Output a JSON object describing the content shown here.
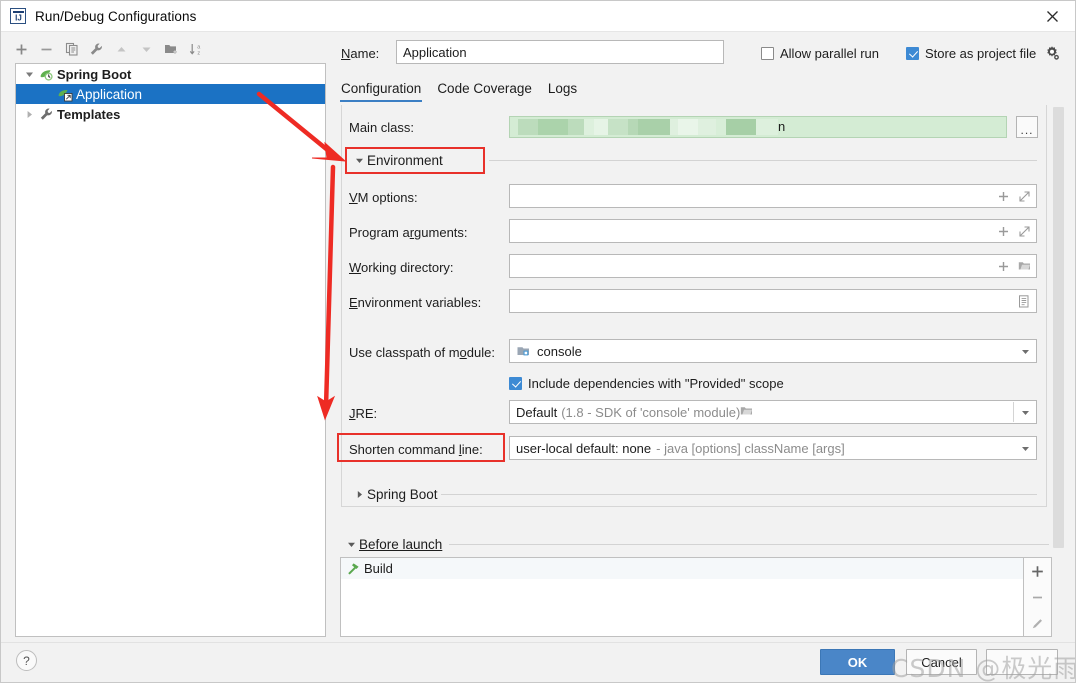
{
  "window": {
    "title": "Run/Debug Configurations",
    "app_icon": "intellij-idea-icon",
    "close_label": "✕"
  },
  "toolbar": {
    "items": [
      {
        "name": "add-configuration-button",
        "icon": "plus-icon",
        "label": "+"
      },
      {
        "name": "remove-configuration-button",
        "icon": "minus-icon",
        "label": "−"
      },
      {
        "name": "copy-configuration-button",
        "icon": "copy-icon",
        "label": "Copy"
      },
      {
        "name": "edit-templates-button",
        "icon": "wrench-icon",
        "label": "Edit Templates"
      },
      {
        "name": "move-up-button",
        "icon": "arrow-up-icon",
        "label": "Move Up"
      },
      {
        "name": "move-down-button",
        "icon": "arrow-down-icon",
        "label": "Move Down"
      },
      {
        "name": "move-into-folder-button",
        "icon": "folder-add-icon",
        "label": "Move into new folder"
      },
      {
        "name": "sort-configurations-button",
        "icon": "sort-az-icon",
        "label": "Sort Configurations"
      }
    ]
  },
  "tree": {
    "nodes": [
      {
        "label": "Spring Boot",
        "icon": "spring-boot-icon",
        "expanded": true,
        "selected": false,
        "level": 0
      },
      {
        "label": "Application",
        "icon": "spring-boot-run-icon",
        "expanded": false,
        "selected": true,
        "level": 1
      },
      {
        "label": "Templates",
        "icon": "wrench-icon",
        "expanded": false,
        "selected": false,
        "level": 0
      }
    ]
  },
  "header": {
    "name_label": "Name:",
    "name_label_mnemonic": "N",
    "name_value": "Application",
    "name_placeholder": "",
    "allow_parallel_run": {
      "label": "Allow parallel run",
      "checked": false
    },
    "store_as_project_file": {
      "label": "Store as project file",
      "checked": true
    },
    "gear_icon": "gear-icon"
  },
  "tabs": [
    {
      "label": "Configuration",
      "active": true
    },
    {
      "label": "Code Coverage",
      "active": false
    },
    {
      "label": "Logs",
      "active": false
    }
  ],
  "configuration": {
    "main_class": {
      "label": "Main class:",
      "value": "n",
      "redacted": true,
      "bg_color": "#d4ecd4",
      "browse_label": "..."
    },
    "environment_section": {
      "label": "Environment",
      "expanded": true
    },
    "vm_options": {
      "label": "VM options:",
      "value": "",
      "macro_icon": "plus-icon",
      "expand_icon": "expand-icon"
    },
    "program_arguments": {
      "label": "Program arguments:",
      "value": "",
      "macro_icon": "plus-icon",
      "expand_icon": "expand-icon"
    },
    "working_directory": {
      "label": "Working directory:",
      "value": "",
      "macro_icon": "plus-icon",
      "browse_icon": "folder-icon"
    },
    "environment_variables": {
      "label": "Environment variables:",
      "value": "",
      "browse_icon": "list-edit-icon"
    },
    "use_classpath_of_module": {
      "label": "Use classpath of module:",
      "value": "console",
      "icon": "module-icon",
      "dropdown_icon": "chevron-down-icon"
    },
    "include_provided": {
      "label": "Include dependencies with \"Provided\" scope",
      "checked": true
    },
    "jre": {
      "label": "JRE:",
      "value": "Default",
      "hint": "(1.8 - SDK of 'console' module)",
      "browse_icon": "folder-icon",
      "dropdown_icon": "chevron-down-icon"
    },
    "shorten_command_line": {
      "label": "Shorten command line:",
      "value": "user-local default: none",
      "hint": "- java [options] className [args]",
      "dropdown_icon": "chevron-down-icon"
    },
    "spring_boot_section": {
      "label": "Spring Boot",
      "expanded": false
    }
  },
  "before_launch": {
    "section_label": "Before launch",
    "expanded": true,
    "tasks": [
      {
        "label": "Build",
        "icon": "build-hammer-icon"
      }
    ],
    "side_buttons": [
      {
        "name": "add-task-button",
        "icon": "plus-icon",
        "label": "+"
      },
      {
        "name": "remove-task-button",
        "icon": "minus-icon",
        "label": "−"
      },
      {
        "name": "edit-task-button",
        "icon": "pencil-icon",
        "label": "Edit"
      }
    ]
  },
  "footer": {
    "help_label": "?",
    "ok_label": "OK",
    "cancel_label": "Cancel",
    "apply_label": ""
  },
  "watermark": {
    "text": "CSDN @极光雨雨"
  },
  "annotations": {
    "accent_color": "#e8312a",
    "boxes": [
      {
        "name": "environment-highlight",
        "target": "Environment"
      },
      {
        "name": "shorten-command-line-highlight",
        "target": "Shorten command line:"
      }
    ],
    "arrows": [
      {
        "name": "arrow-to-environment",
        "from": "tree-application",
        "to": "Environment"
      },
      {
        "name": "arrow-to-jre",
        "from": "Environment",
        "to": "JRE"
      }
    ]
  }
}
